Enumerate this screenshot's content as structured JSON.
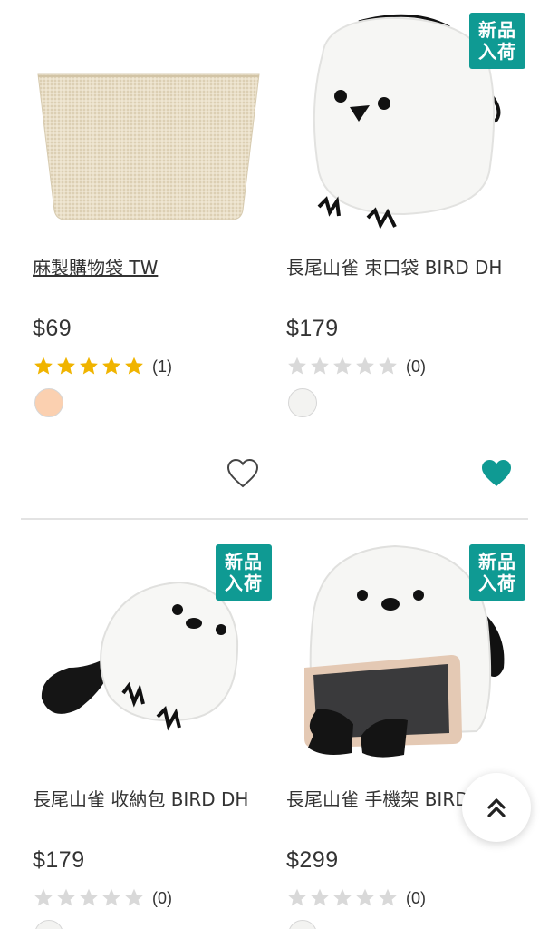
{
  "products": [
    {
      "name": "麻製購物袋 TW",
      "price": "$69",
      "rating_count": "(1)",
      "stars_filled": 5,
      "swatch": "#fbd0b0",
      "badge": "",
      "favorited": false,
      "image": "jute-tote-bag"
    },
    {
      "name": "長尾山雀 束口袋 BIRD DH",
      "price": "$179",
      "rating_count": "(0)",
      "stars_filled": 0,
      "swatch": "#f3f3f1",
      "badge": "新品\n入荷",
      "favorited": true,
      "image": "plush-bird-drawstring-bag"
    },
    {
      "name": "長尾山雀 收納包 BIRD DH",
      "price": "$179",
      "rating_count": "(0)",
      "stars_filled": 0,
      "swatch": "#f3f3f1",
      "badge": "新品\n入荷",
      "favorited": false,
      "image": "plush-bird-pouch"
    },
    {
      "name": "長尾山雀 手機架 BIRD DH",
      "price": "$299",
      "rating_count": "(0)",
      "stars_filled": 0,
      "swatch": "#f3f3f1",
      "badge": "新品\n入荷",
      "favorited": false,
      "image": "plush-bird-phone-stand"
    }
  ],
  "colors": {
    "accent": "#0f9a93",
    "star_filled": "#f0b400",
    "star_empty": "#d9d9d9"
  },
  "scroll_top_icon": "double-chevron-up-icon"
}
